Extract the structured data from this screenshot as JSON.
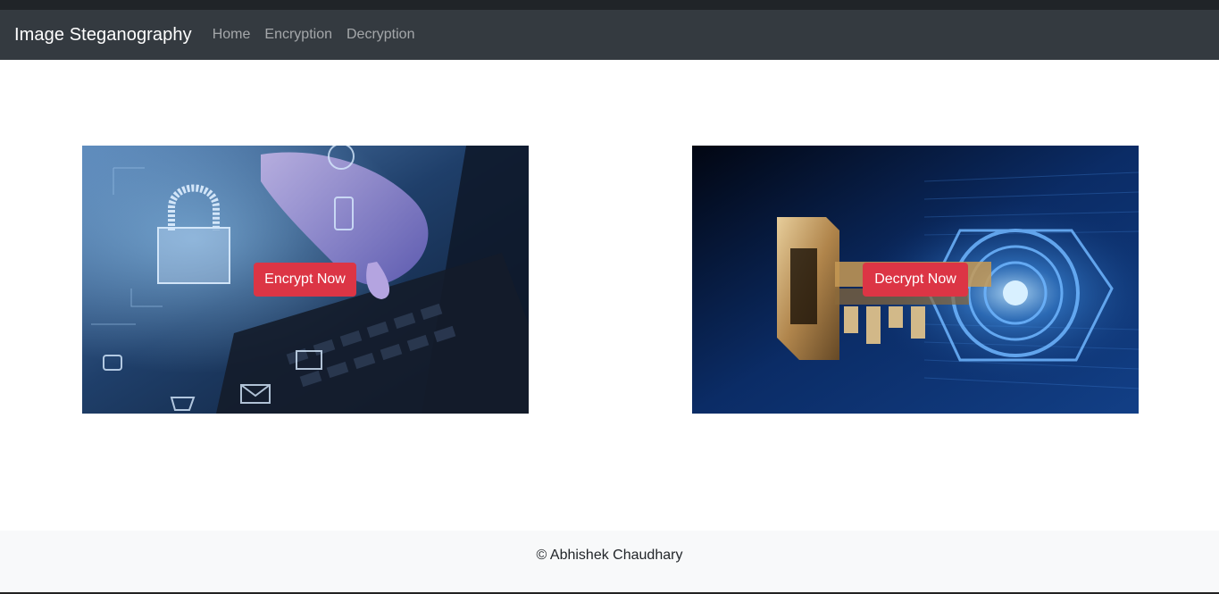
{
  "navbar": {
    "brand": "Image Steganography",
    "links": [
      "Home",
      "Encryption",
      "Decryption"
    ]
  },
  "cards": [
    {
      "button_label": "Encrypt Now",
      "image_subject": "hand on laptop keyboard with glowing padlock and security icons"
    },
    {
      "button_label": "Decrypt Now",
      "image_subject": "golden digital key with binary code on blue background"
    }
  ],
  "footer": {
    "text": "© Abhishek Chaudhary"
  },
  "colors": {
    "navbar_bg": "#343a40",
    "button_danger": "#dc3545",
    "footer_bg": "#f8f9fa"
  }
}
